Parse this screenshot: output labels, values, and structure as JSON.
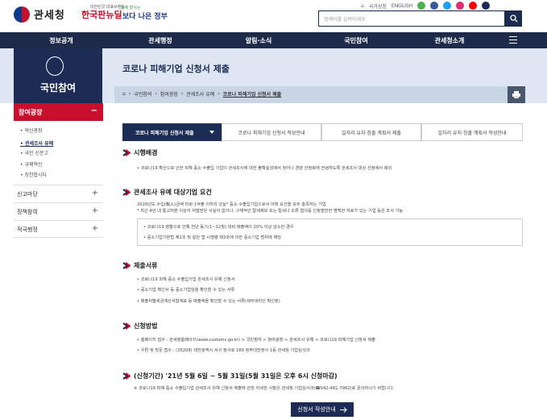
{
  "header": {
    "logo_text": "관세청",
    "kp_small": "대한민국 대표브랜드",
    "kp_text": "한국판뉴딜",
    "gov_small": "함께 잘사는",
    "gov_text": "보다 나은 정부",
    "top_links": [
      "국가상징",
      "ENGLISH"
    ],
    "search_placeholder": "검색어를 입력하세요"
  },
  "gnb": {
    "items": [
      "정보공개",
      "관세행정",
      "알림·소식",
      "국민참여",
      "관세청소개"
    ]
  },
  "visual": {
    "section_title": "국민참여",
    "page_title": "코로나 피해기업 신청서 제출",
    "breadcrumb": [
      "국민참여",
      "참여광장",
      "관세조사 유예",
      "코로나 피해기업 신청서 제출"
    ]
  },
  "sidebar": {
    "head": "참여광장",
    "subs": [
      "혁신광장",
      "관세조사 유예",
      "국민 신문고",
      "규제혁신",
      "징찬합시다"
    ],
    "items": [
      "신고마당",
      "정책참여",
      "적극행정"
    ]
  },
  "tabs": [
    "코로나 피해기업 신청서 제출",
    "코로나 피해기업 신청서 작성안내",
    "일자리 유지·창출 계획서 제출",
    "일자리 유지·창출 계획서 작성안내"
  ],
  "sections": {
    "s1_title": "시행배경",
    "s1_b1": "코로나19 확산으로 인한 피해 중소 수출입 기업이 관세조사에 대한 불확실성에서 벗어나 경영 안정화에 전념하도록 관세조사 대상 선정에서 제외",
    "s2_title": "관세조사 유예 대상기업 요건",
    "s2_n1": "2020년도 수입(輸入)금액 미화 1억불 이하의 성실* 중소 수출입기업으로서 아래 요건을 모두 충족하는 기업",
    "s2_n2": "* 최근 4년 내 통고처분 이상의 처벌받은 사실이 없거나, 구체적인 탈세제보 또는 탈세나 오류 혐의를 인정할만한 명백한 자료가 있는 기업 등은 조사 가능",
    "s2_b1": "코로나19 영향으로 인해 전년 동기(1~12월) 대비 매출액이 20% 이상 감소한 경우",
    "s2_b2": "중소기업기본법 제2조 및 같은 법 시행령 제3조에 의한 중소기업 범위에 해당",
    "s3_title": "제출서류",
    "s3_b1": "코로나19 피해 중소 수출입기업 관세조사 유예 신청서",
    "s3_b2": "중소기업 확인서 등 중소기업임을 확인할 수 있는 서류",
    "s3_b3": "매출처별세금계산서합계표 등 매출액을 확인할 수 있는 서류(세무대리인 확인분)",
    "s4_title": "신청방법",
    "s4_b1": "홈페이지 접수 : 관세청홈페이지(www.customs.go.kr) > 국민참여 > 참여광장 > 관세조사 유예 > 코로나19 피해기업 신청서 제출",
    "s4_b2": "우편 및 방문 접수 : (35208) 대전광역시 서구 청사로 189 정부대전청사 1동 관세청 기업심사과",
    "period": "(신청기간) '21년 5월 6일 ~ 5월 31일(5월 31일은 오후 6시 신청마감)",
    "contact": "※  코로나19 피해 중소 수출입기업 관세조사 유예 신청서 제출에 관한 자세한 사항은 관세청 기업심사과(☎042-481-7982)로 문의하시기 바랍니다."
  },
  "submit": {
    "label": "신청서 작성안내"
  },
  "colors": {
    "navy": "#1d2c55",
    "red": "#c8102e",
    "band": "#dde6f2"
  }
}
